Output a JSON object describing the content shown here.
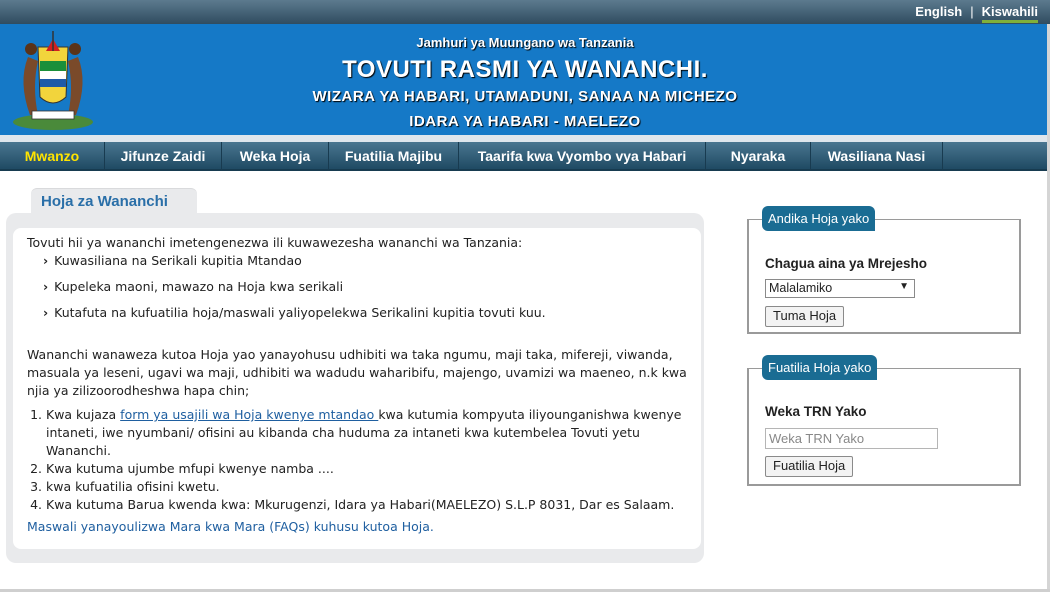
{
  "lang": {
    "english": "English",
    "separator": "|",
    "kiswahili": "Kiswahili"
  },
  "header": {
    "line1": "Jamhuri ya Muungano wa Tanzania",
    "title": "TOVUTI RASMI YA WANANCHI.",
    "line3": "WIZARA YA HABARI, UTAMADUNI, SANAA NA MICHEZO",
    "line4": "IDARA YA HABARI - MAELEZO",
    "emblem_icon": "coat-of-arms-icon"
  },
  "nav": [
    "Mwanzo",
    "Jifunze Zaidi",
    "Weka Hoja",
    "Fuatilia Majibu",
    "Taarifa kwa Vyombo vya Habari",
    "Nyaraka",
    "Wasiliana Nasi"
  ],
  "main": {
    "tab": "Hoja za Wananchi",
    "intro": "Tovuti hii ya wananchi imetengenezwa ili kuwawezesha wananchi wa Tanzania:",
    "bullets": [
      "Kuwasiliana na Serikali kupitia Mtandao",
      "Kupeleka maoni, mawazo na Hoja kwa serikali",
      "Kutafuta na kufuatilia hoja/maswali yaliyopelekwa Serikalini kupitia tovuti kuu."
    ],
    "para1": "Wananchi wanaweza kutoa Hoja yao yanayohusu udhibiti wa taka ngumu, maji taka, mifereji, viwanda,",
    "para2": "masuala ya leseni, ugavi wa maji, udhibiti wa wadudu waharibifu, majengo, uvamizi wa maeneo, n.k kwa",
    "para3": "njia ya zilizoorodheshwa hapa chin;",
    "list1_pre": "Kwa kujaza ",
    "list1_link": "form ya usajili wa Hoja kwenye mtandao ",
    "list1_post": "kwa kutumia kompyuta iliyounganishwa kwenye",
    "list1_line2": "intaneti, iwe nyumbani/ ofisini au kibanda cha huduma za intaneti kwa kutembelea Tovuti yetu",
    "list1_line3": "Wananchi.",
    "list2": "Kwa kutuma ujumbe mfupi kwenye namba ....",
    "list3": "kwa kufuatilia ofisini kwetu.",
    "list4": "Kwa kutuma Barua kwenda kwa: Mkurugenzi, Idara ya Habari(MAELEZO) S.L.P 8031, Dar es Salaam.",
    "faq": "Maswali yanayoulizwa Mara kwa Mara (FAQs) kuhusu kutoa Hoja."
  },
  "box1": {
    "legend": "Andika Hoja yako",
    "label": "Chagua aina ya Mrejesho",
    "selected": "Malalamiko",
    "button": "Tuma Hoja"
  },
  "box2": {
    "legend": "Fuatilia Hoja yako",
    "label": "Weka TRN Yako",
    "placeholder": "Weka TRN Yako",
    "button": "Fuatilia Hoja"
  },
  "colors": {
    "header_blue": "#1579c7",
    "nav_active": "#ffe400",
    "legend_bg": "#1a6c93",
    "link": "#1f5fa0"
  }
}
